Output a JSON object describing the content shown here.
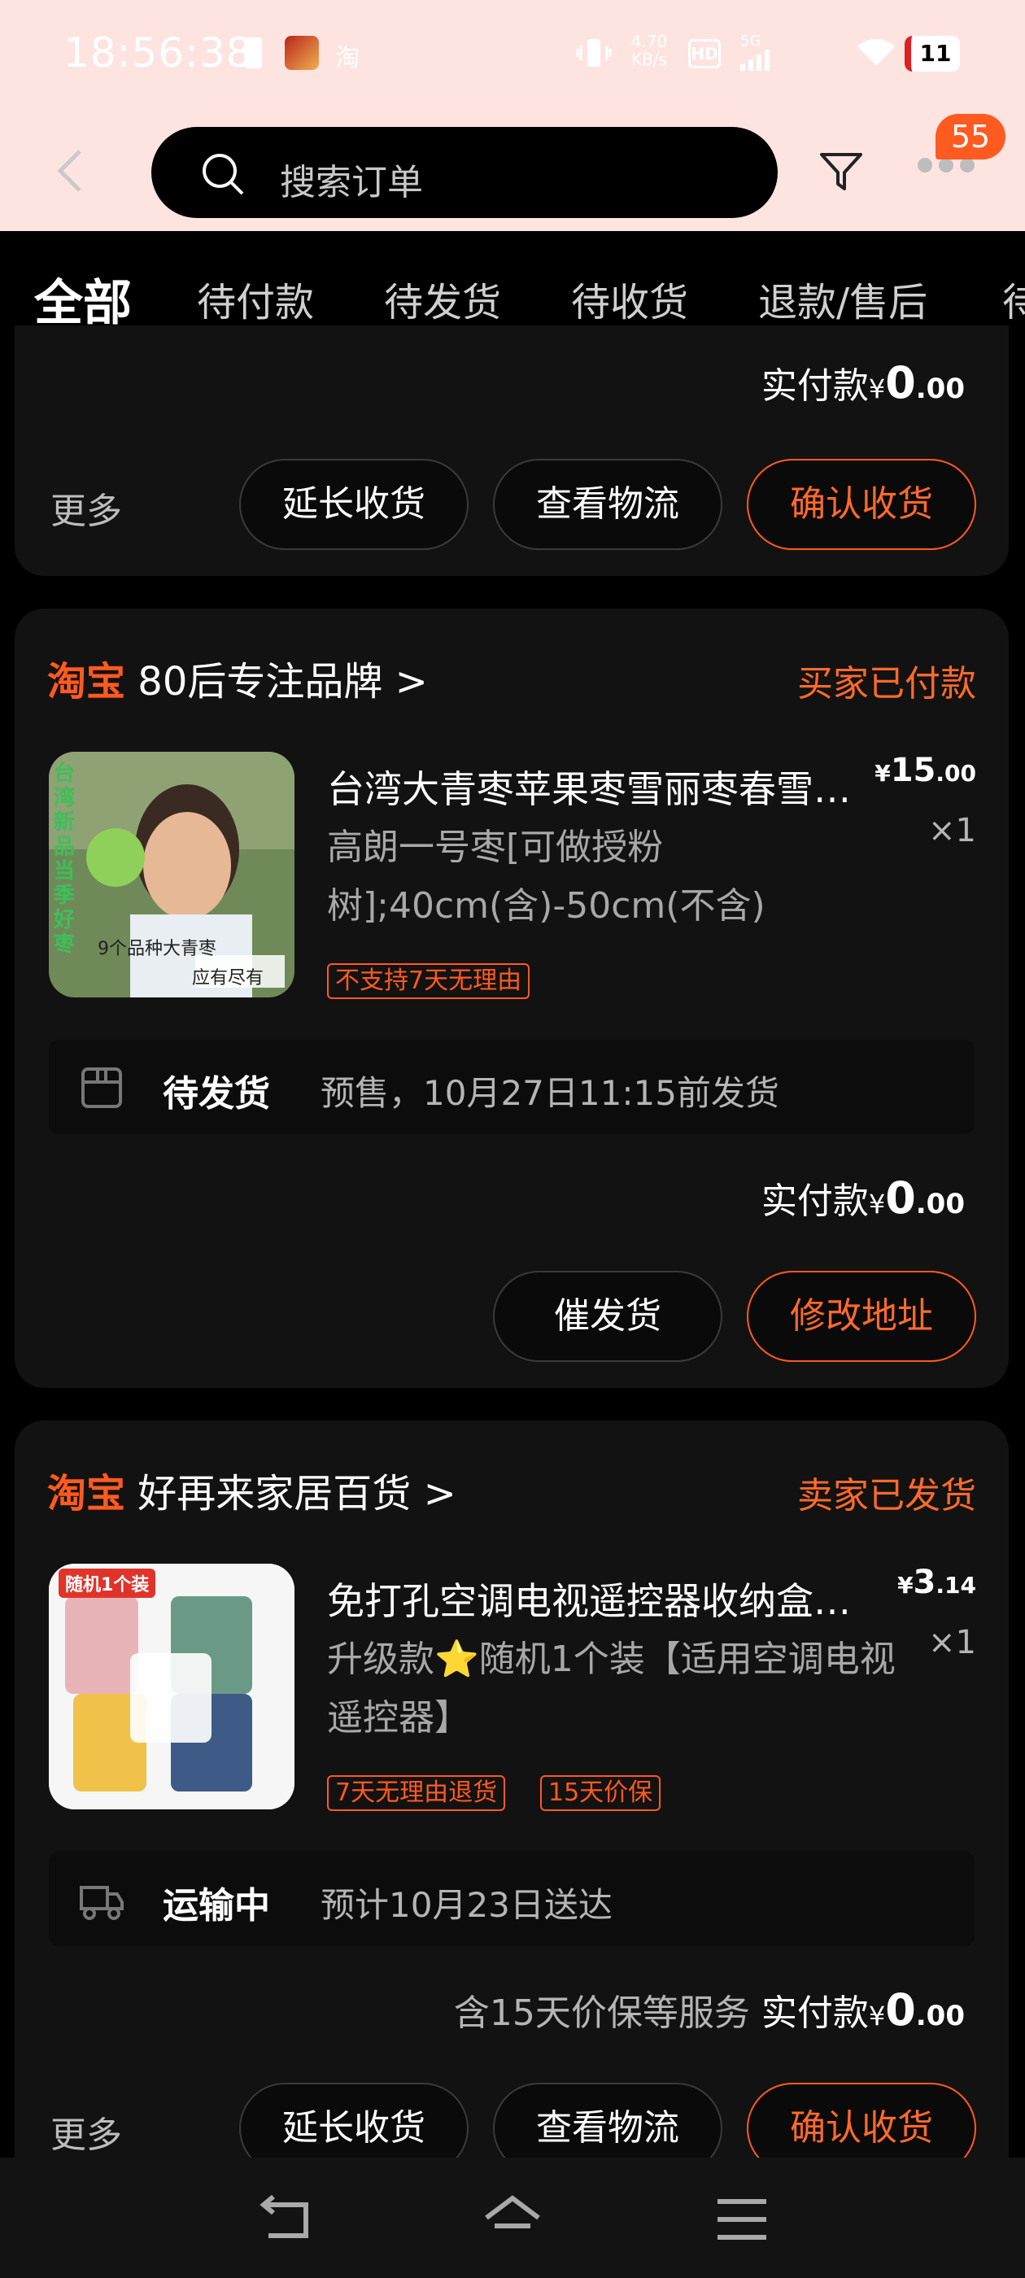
{
  "status_bar": {
    "time": "18:56:38",
    "app_icon": "淘",
    "net_speed_value": "4.70",
    "net_speed_unit": "KB/s",
    "hd_label": "HD",
    "signal_label": "5G",
    "battery": "11"
  },
  "header": {
    "search_placeholder": "搜索订单",
    "badge": "55"
  },
  "tabs": [
    {
      "label": "全部",
      "active": true
    },
    {
      "label": "待付款"
    },
    {
      "label": "待发货"
    },
    {
      "label": "待收货"
    },
    {
      "label": "退款/售后"
    },
    {
      "label": "待"
    }
  ],
  "order1": {
    "paid_label": "实付款",
    "currency": "¥",
    "paid_int": "0",
    "paid_dec": ".00",
    "more": "更多",
    "buttons": [
      "延长收货",
      "查看物流",
      "确认收货"
    ]
  },
  "order2": {
    "platform": "淘宝",
    "shop": "80后专注品牌",
    "chevron": ">",
    "status": "买家已付款",
    "title": "台湾大青枣苹果枣雪丽枣春雪…",
    "sku": "高朗一号枣[可做授粉树];40cm(含)-50cm(不含)",
    "price_int": "15",
    "price_dec": ".00",
    "currency": "¥",
    "qty": "×1",
    "tags": [
      "不支持7天无理由"
    ],
    "thumb_text_1": "台湾新品当季好枣",
    "thumb_text_2": "9个品种大青枣",
    "thumb_text_3": "应有尽有",
    "ship_status": "待发货",
    "ship_desc": "预售，10月27日11:15前发货",
    "paid_label": "实付款",
    "paid_int": "0",
    "paid_dec": ".00",
    "buttons": [
      "催发货",
      "修改地址"
    ]
  },
  "order3": {
    "platform": "淘宝",
    "shop": "好再来家居百货",
    "chevron": ">",
    "status": "卖家已发货",
    "title": "免打孔空调电视遥控器收纳盒…",
    "sku": "升级款⭐随机1个装【适用空调电视遥控器】",
    "price_int": "3",
    "price_dec": ".14",
    "currency": "¥",
    "qty": "×1",
    "tags": [
      "7天无理由退货",
      "15天价保"
    ],
    "thumb_badge": "随机1个装",
    "ship_status": "运输中",
    "ship_desc": "预计10月23日送达",
    "service_note": "含15天价保等服务",
    "paid_label": "实付款",
    "paid_int": "0",
    "paid_dec": ".00",
    "more": "更多",
    "buttons": [
      "延长收货",
      "查看物流",
      "确认收货"
    ]
  },
  "icons": {
    "back": "chevron-left-icon",
    "search": "search-icon",
    "filter": "filter-icon",
    "more": "more-dots-icon",
    "nav": [
      "back-nav-icon",
      "home-nav-icon",
      "menu-nav-icon"
    ]
  },
  "colors": {
    "accent": "#ff5a1f",
    "header_bg": "#fde4e1",
    "page_bg": "#000000",
    "card_bg": "#121212"
  }
}
